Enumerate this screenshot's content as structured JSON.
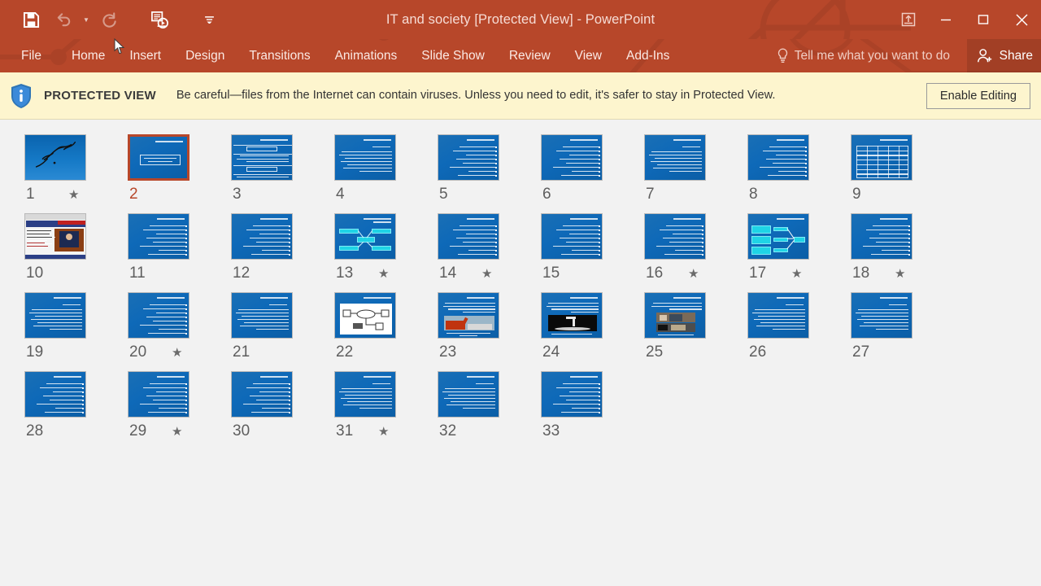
{
  "window": {
    "title": "IT and society [Protected View] - PowerPoint",
    "quick_access": [
      {
        "name": "save-icon",
        "label": "Save",
        "enabled": true
      },
      {
        "name": "undo-icon",
        "label": "Undo",
        "enabled": false
      },
      {
        "name": "redo-icon",
        "label": "Redo",
        "enabled": false
      },
      {
        "name": "start-from-beginning-icon",
        "label": "Start From Beginning",
        "enabled": true
      },
      {
        "name": "customize-quick-access-toolbar-icon",
        "label": "Customize Quick Access Toolbar",
        "enabled": true
      }
    ],
    "controls": {
      "ribbon_display_options": "Ribbon Display Options",
      "minimize": "Minimize",
      "restore": "Restore Down",
      "close": "Close"
    },
    "accent_color": "#b7472a"
  },
  "ribbon": {
    "tabs": [
      {
        "label": "File"
      },
      {
        "label": "Home",
        "active": true
      },
      {
        "label": "Insert"
      },
      {
        "label": "Design"
      },
      {
        "label": "Transitions"
      },
      {
        "label": "Animations"
      },
      {
        "label": "Slide Show"
      },
      {
        "label": "Review"
      },
      {
        "label": "View"
      },
      {
        "label": "Add-Ins"
      }
    ],
    "tell_me": "Tell me what you want to do",
    "share": "Share"
  },
  "protected_view": {
    "label": "PROTECTED VIEW",
    "message": "Be careful—files from the Internet can contain viruses. Unless you need to edit, it's safer to stay in Protected View.",
    "button": "Enable Editing",
    "background_color": "#fdf5ce"
  },
  "slide_sorter": {
    "selected_slide": 2,
    "slides": [
      {
        "number": "1",
        "animated": true,
        "selected": false,
        "kind": "calligraphy"
      },
      {
        "number": "2",
        "animated": false,
        "selected": true,
        "kind": "title"
      },
      {
        "number": "3",
        "animated": false,
        "selected": false,
        "kind": "bands"
      },
      {
        "number": "4",
        "animated": false,
        "selected": false,
        "kind": "para"
      },
      {
        "number": "5",
        "animated": false,
        "selected": false,
        "kind": "bullets"
      },
      {
        "number": "6",
        "animated": false,
        "selected": false,
        "kind": "bullets"
      },
      {
        "number": "7",
        "animated": false,
        "selected": false,
        "kind": "para"
      },
      {
        "number": "8",
        "animated": false,
        "selected": false,
        "kind": "bullets"
      },
      {
        "number": "9",
        "animated": false,
        "selected": false,
        "kind": "table"
      },
      {
        "number": "10",
        "animated": false,
        "selected": false,
        "kind": "webshot"
      },
      {
        "number": "11",
        "animated": false,
        "selected": false,
        "kind": "bullets"
      },
      {
        "number": "12",
        "animated": false,
        "selected": false,
        "kind": "bullets"
      },
      {
        "number": "13",
        "animated": true,
        "selected": false,
        "kind": "diagram-x"
      },
      {
        "number": "14",
        "animated": true,
        "selected": false,
        "kind": "bullets"
      },
      {
        "number": "15",
        "animated": false,
        "selected": false,
        "kind": "bullets"
      },
      {
        "number": "16",
        "animated": true,
        "selected": false,
        "kind": "bullets"
      },
      {
        "number": "17",
        "animated": true,
        "selected": false,
        "kind": "diagram-merge"
      },
      {
        "number": "18",
        "animated": true,
        "selected": false,
        "kind": "bullets"
      },
      {
        "number": "19",
        "animated": false,
        "selected": false,
        "kind": "para"
      },
      {
        "number": "20",
        "animated": true,
        "selected": false,
        "kind": "bullets"
      },
      {
        "number": "21",
        "animated": false,
        "selected": false,
        "kind": "para"
      },
      {
        "number": "22",
        "animated": false,
        "selected": false,
        "kind": "netdiagram"
      },
      {
        "number": "23",
        "animated": false,
        "selected": false,
        "kind": "photo-robot"
      },
      {
        "number": "24",
        "animated": false,
        "selected": false,
        "kind": "photo-dark"
      },
      {
        "number": "25",
        "animated": false,
        "selected": false,
        "kind": "photo-two"
      },
      {
        "number": "26",
        "animated": false,
        "selected": false,
        "kind": "para"
      },
      {
        "number": "27",
        "animated": false,
        "selected": false,
        "kind": "para"
      },
      {
        "number": "28",
        "animated": false,
        "selected": false,
        "kind": "bullets"
      },
      {
        "number": "29",
        "animated": true,
        "selected": false,
        "kind": "bullets"
      },
      {
        "number": "30",
        "animated": false,
        "selected": false,
        "kind": "bullets"
      },
      {
        "number": "31",
        "animated": true,
        "selected": false,
        "kind": "para"
      },
      {
        "number": "32",
        "animated": false,
        "selected": false,
        "kind": "para"
      },
      {
        "number": "33",
        "animated": false,
        "selected": false,
        "kind": "bullets"
      }
    ],
    "animation_marker": "★"
  }
}
